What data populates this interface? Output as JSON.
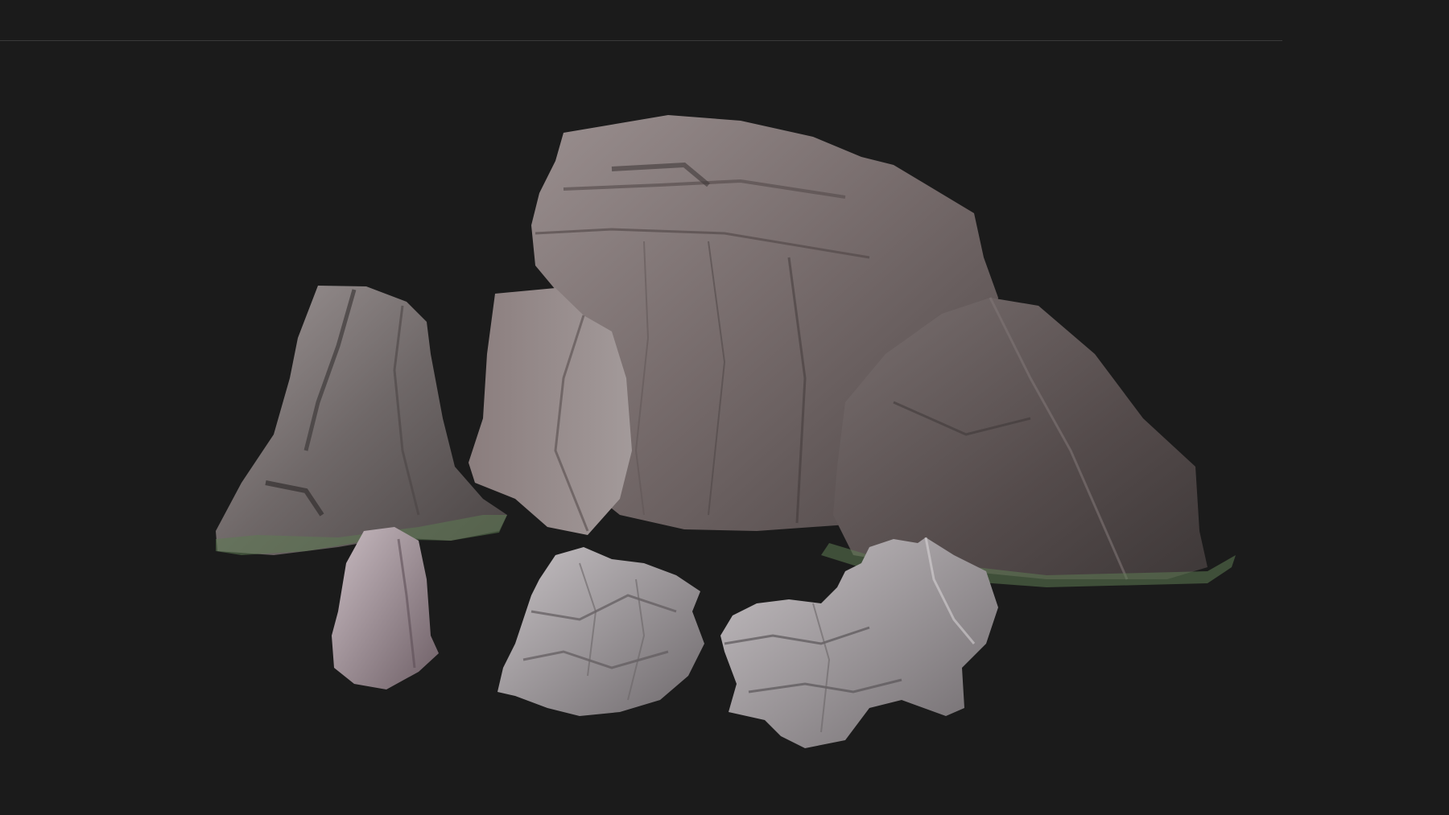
{
  "scene": {
    "background_color": "#1b1b1b",
    "rule_color": "#3a3a3a",
    "assets": [
      {
        "name": "big-cliff-boulder",
        "color": "#7a6d6d"
      },
      {
        "name": "leaning-boulder",
        "color": "#5f5656"
      },
      {
        "name": "tall-pillar-rock",
        "color": "#787070"
      },
      {
        "name": "split-slab-rock",
        "color": "#8a7f7f"
      },
      {
        "name": "small-standing-stone",
        "color": "#8a7a80"
      },
      {
        "name": "rubble-pile-center",
        "color": "#9a9398"
      },
      {
        "name": "rubble-pile-right",
        "color": "#9c9799"
      }
    ],
    "moss_color": "#5d7a52"
  }
}
